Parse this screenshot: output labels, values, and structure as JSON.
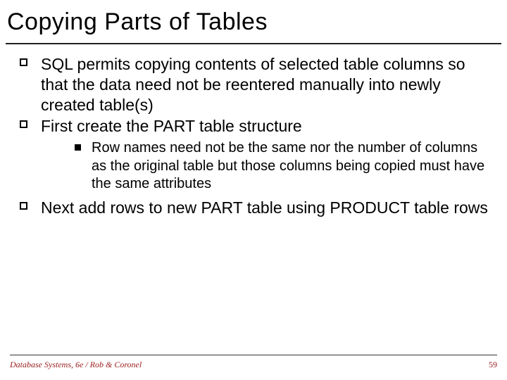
{
  "title": "Copying Parts of Tables",
  "bullets": {
    "b1": "SQL permits copying contents of selected table columns so that the data need not be reentered manually into newly created table(s)",
    "b2": "First create the PART table structure",
    "b2_sub1": "Row names need not be the same nor the number of columns as the original table but those columns being copied must have the same attributes",
    "b3": "Next add rows to new PART table using PRODUCT table rows"
  },
  "footer": {
    "source": "Database Systems, 6e / Rob & Coronel",
    "page": "59"
  }
}
